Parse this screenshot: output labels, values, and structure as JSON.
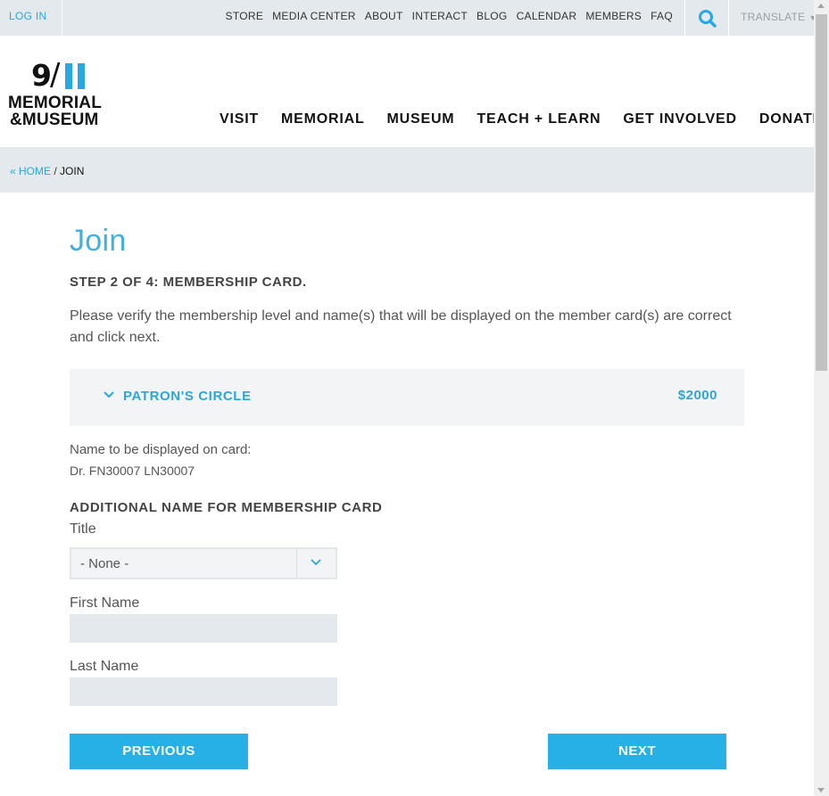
{
  "utility": {
    "login": "LOG IN",
    "links": [
      "STORE",
      "MEDIA CENTER",
      "ABOUT",
      "INTERACT",
      "BLOG",
      "CALENDAR",
      "MEMBERS",
      "FAQ"
    ],
    "search_icon": "search-icon",
    "translate": "TRANSLATE",
    "translate_caret": "▼"
  },
  "logo": {
    "nine": "9",
    "slash": "/",
    "line1": "MEMORIAL",
    "line2": "&MUSEUM"
  },
  "nav": [
    "VISIT",
    "MEMORIAL",
    "MUSEUM",
    "TEACH + LEARN",
    "GET INVOLVED",
    "DONATE"
  ],
  "breadcrumb": {
    "home": "« HOME",
    "separator": " / ",
    "current": "JOIN"
  },
  "page": {
    "title": "Join",
    "step": "STEP 2 OF 4: MEMBERSHIP CARD.",
    "intro": "Please verify the membership level and name(s) that will be displayed on the member card(s) are correct and click next."
  },
  "level": {
    "name": "PATRON'S CIRCLE",
    "price": "$2000"
  },
  "card": {
    "name_label": "Name to be displayed on card:",
    "name_value": "Dr. FN30007 LN30007"
  },
  "additional": {
    "heading": "ADDITIONAL NAME FOR MEMBERSHIP CARD",
    "title_label": "Title",
    "title_value": "- None -",
    "first_name_label": "First Name",
    "first_name_value": "",
    "last_name_label": "Last Name",
    "last_name_value": ""
  },
  "buttons": {
    "previous": "PREVIOUS",
    "next": "NEXT"
  },
  "colors": {
    "accent": "#27b0e6",
    "bar_bg": "#e3e9ec"
  }
}
